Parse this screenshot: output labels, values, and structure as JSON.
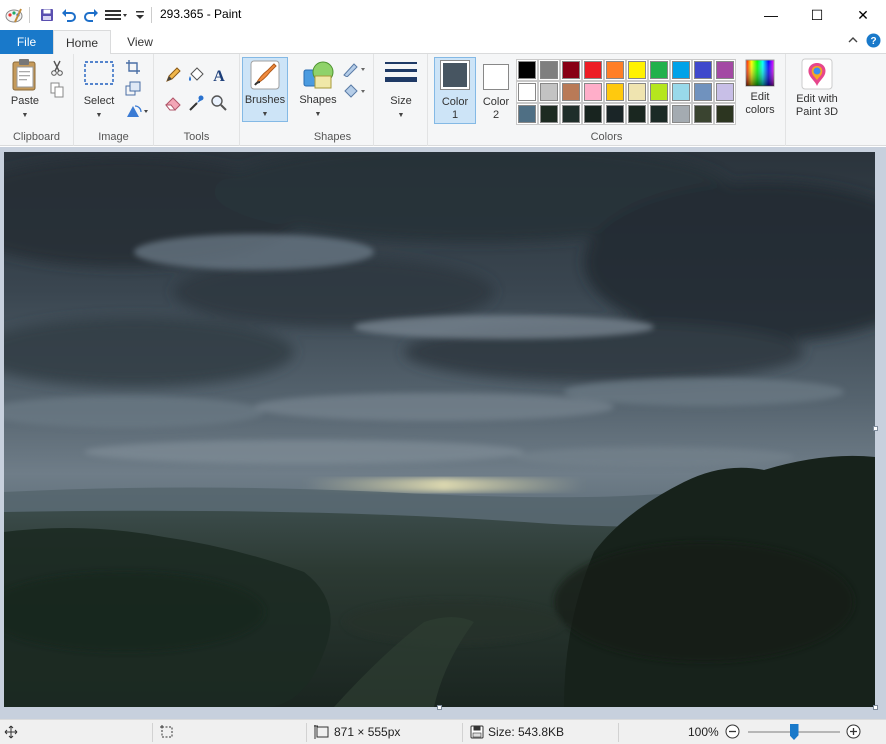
{
  "window": {
    "title": "293.365 - Paint",
    "minimize_glyph": "—",
    "maximize_glyph": "☐",
    "close_glyph": "✕"
  },
  "quick_access": {
    "icons": [
      "paint-app-icon",
      "save-icon",
      "undo-icon",
      "redo-icon",
      "customize-toolbar-icon"
    ]
  },
  "tabs": {
    "file": "File",
    "home": "Home",
    "view": "View"
  },
  "ribbon": {
    "clipboard": {
      "label": "Clipboard",
      "paste": "Paste"
    },
    "image": {
      "label": "Image",
      "select": "Select"
    },
    "tools": {
      "label": "Tools"
    },
    "brushes": {
      "label": "Brushes"
    },
    "shapes": {
      "label": "Shapes",
      "button": "Shapes"
    },
    "size": {
      "label": "Size"
    },
    "color1": {
      "line1": "Color",
      "line2": "1",
      "value": "#475561"
    },
    "color2": {
      "line1": "Color",
      "line2": "2",
      "value": "#ffffff"
    },
    "colors": {
      "label": "Colors"
    },
    "edit_colors": {
      "line1": "Edit",
      "line2": "colors"
    },
    "paint3d": {
      "line1": "Edit with",
      "line2": "Paint 3D"
    }
  },
  "palette": [
    "#000000",
    "#7f7f7f",
    "#880015",
    "#ed1c24",
    "#ff7f27",
    "#fff200",
    "#22b14c",
    "#00a2e8",
    "#3f48cc",
    "#a349a4",
    "#ffffff",
    "#c3c3c3",
    "#b97a57",
    "#ffaec9",
    "#ffc90e",
    "#efe4b0",
    "#b5e61d",
    "#99d9ea",
    "#7092be",
    "#c8bfe7",
    "#4f6f84",
    "#1d2b22",
    "#1f2e2a",
    "#18241f",
    "#1a2527",
    "#1a2720",
    "#1b2a26",
    "#a4abb1",
    "#3a4430",
    "#2c3520"
  ],
  "status": {
    "dimensions": "871 × 555px",
    "size": "Size: 543.8KB",
    "zoom": "100%",
    "zoom_level": 0.5
  }
}
